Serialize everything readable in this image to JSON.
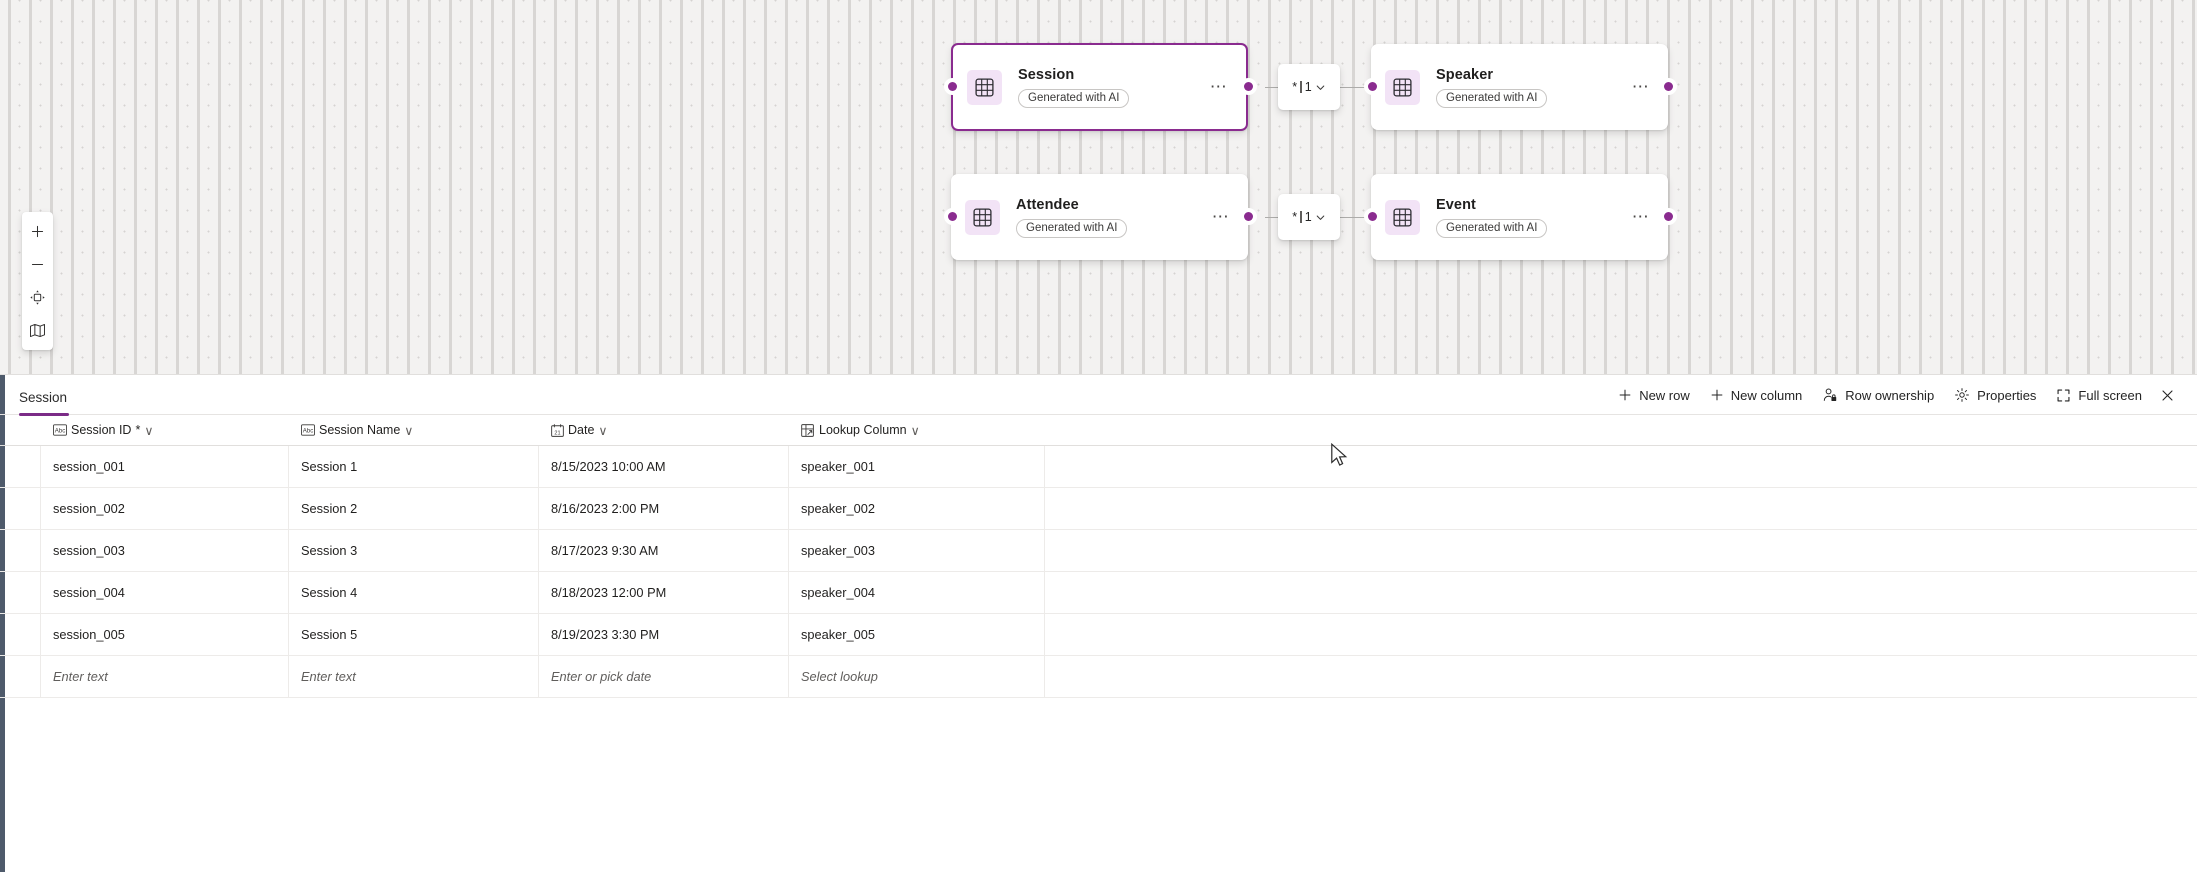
{
  "canvas": {
    "zoom_toolbar": {
      "items": [
        {
          "name": "zoom-in",
          "label": "+"
        },
        {
          "name": "zoom-out",
          "label": "−"
        },
        {
          "name": "fit-to-screen",
          "label": "Fit to screen"
        },
        {
          "name": "minimap",
          "label": "Minimap"
        }
      ]
    },
    "nodes": [
      {
        "title": "Session",
        "badge": "Generated with AI",
        "icon": "table-icon",
        "selected": true,
        "menu": "⋯"
      },
      {
        "title": "Speaker",
        "badge": "Generated with AI",
        "icon": "table-icon",
        "selected": false,
        "menu": "⋯"
      },
      {
        "title": "Attendee",
        "badge": "Generated with AI",
        "icon": "table-icon",
        "selected": false,
        "menu": "⋯"
      },
      {
        "title": "Event",
        "badge": "Generated with AI",
        "icon": "table-icon",
        "selected": false,
        "menu": "⋯"
      }
    ],
    "relationships": [
      {
        "from": "Session",
        "to": "Speaker",
        "many": "*",
        "one": "1"
      },
      {
        "from": "Attendee",
        "to": "Event",
        "many": "*",
        "one": "1"
      }
    ],
    "colors": {
      "accent": "#8a2b8f",
      "node_icon_bg": "#f2e3f6",
      "background": "#f3f2f1"
    }
  },
  "panel": {
    "tab": "Session",
    "actions": [
      {
        "label": "New row",
        "icon": "plus-icon"
      },
      {
        "label": "New column",
        "icon": "plus-icon"
      },
      {
        "label": "Row ownership",
        "icon": "person-lock-icon"
      },
      {
        "label": "Properties",
        "icon": "gear-icon"
      },
      {
        "label": "Full screen",
        "icon": "expand-icon"
      },
      {
        "label": "",
        "icon": "close-icon"
      }
    ],
    "grid": {
      "columns": [
        {
          "label": "Session ID",
          "icon": "abc-icon",
          "required": true,
          "chevron": "∨"
        },
        {
          "label": "Session Name",
          "icon": "abc-icon",
          "required": false,
          "chevron": "∨"
        },
        {
          "label": "Date",
          "icon": "date-icon",
          "required": false,
          "chevron": "∨"
        },
        {
          "label": "Lookup Column",
          "icon": "lookup-icon",
          "required": false,
          "chevron": "∨"
        }
      ],
      "rows": [
        [
          "session_001",
          "Session 1",
          "8/15/2023 10:00 AM",
          "speaker_001"
        ],
        [
          "session_002",
          "Session 2",
          "8/16/2023 2:00 PM",
          "speaker_002"
        ],
        [
          "session_003",
          "Session 3",
          "8/17/2023 9:30 AM",
          "speaker_003"
        ],
        [
          "session_004",
          "Session 4",
          "8/18/2023 12:00 PM",
          "speaker_004"
        ],
        [
          "session_005",
          "Session 5",
          "8/19/2023 3:30 PM",
          "speaker_005"
        ]
      ],
      "new_row_placeholders": [
        "Enter text",
        "Enter text",
        "Enter or pick date",
        "Select lookup"
      ]
    }
  }
}
